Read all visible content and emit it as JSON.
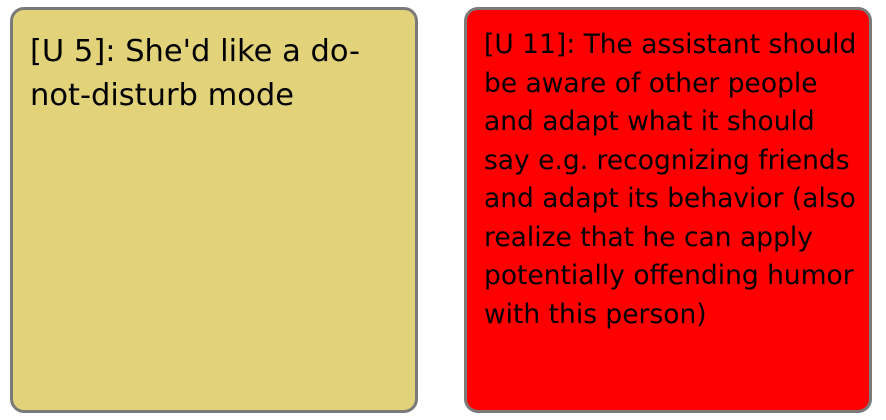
{
  "notes": [
    {
      "id_label": "[U 5]",
      "text": "[U 5]: She'd like a do-not-disturb mode",
      "color": "#e2d27a"
    },
    {
      "id_label": "[U 11]",
      "text": "[U 11]: The assistant should be aware of other people and adapt what it should say e.g. recognizing friends and adapt its behavior (also realize that he can apply potentially offending humor with this person)",
      "color": "#ff0000"
    }
  ],
  "colors": {
    "note_border": "#7a7a7a",
    "text": "#000000",
    "background": "#ffffff"
  }
}
